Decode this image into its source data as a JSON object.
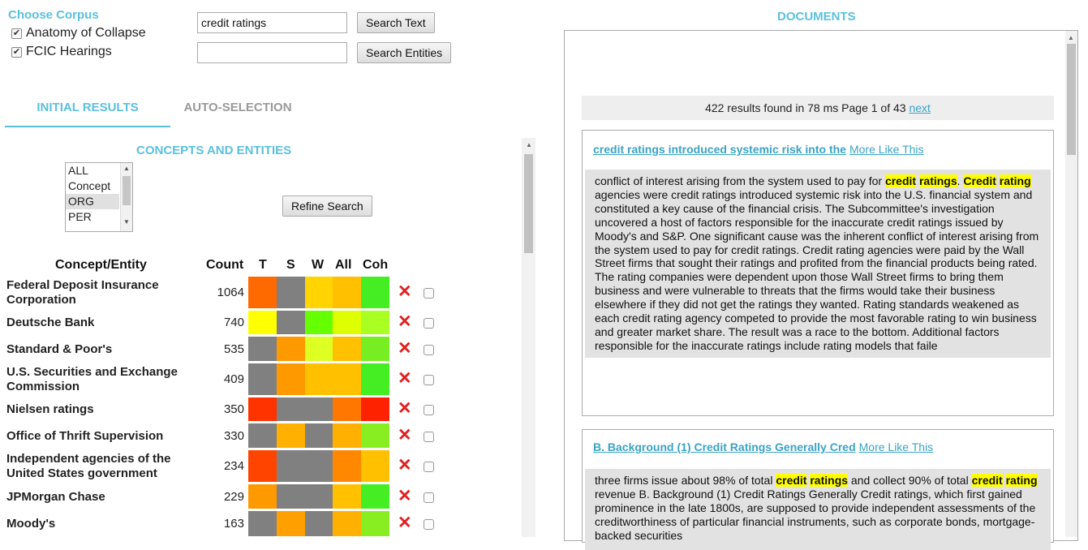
{
  "corpus": {
    "title": "Choose Corpus",
    "items": [
      {
        "label": "Anatomy of Collapse",
        "checked": true
      },
      {
        "label": "FCIC Hearings",
        "checked": true
      }
    ]
  },
  "search": {
    "text_value": "credit ratings",
    "text_button": "Search Text",
    "entities_value": "",
    "entities_button": "Search Entities"
  },
  "tabs": [
    {
      "label": "INITIAL RESULTS",
      "active": true
    },
    {
      "label": "AUTO-SELECTION",
      "active": false
    }
  ],
  "concepts": {
    "title": "CONCEPTS AND ENTITIES",
    "filter_options": [
      "ALL",
      "Concept",
      "ORG",
      "PER"
    ],
    "selected_option": "ORG",
    "refine_button": "Refine Search",
    "headers": {
      "entity": "Concept/Entity",
      "count": "Count",
      "t": "T",
      "s": "S",
      "w": "W",
      "all": "All",
      "coh": "Coh"
    },
    "rows": [
      {
        "name": "Federal Deposit Insurance Corporation",
        "count": "1064",
        "colors": [
          "#ff6a00",
          "#808080",
          "#ffd400",
          "#ffc000",
          "#44ee22"
        ]
      },
      {
        "name": "Deutsche Bank",
        "count": "740",
        "colors": [
          "#ffff00",
          "#808080",
          "#66ff00",
          "#ddff00",
          "#aaff22"
        ]
      },
      {
        "name": "Standard & Poor's",
        "count": "535",
        "colors": [
          "#808080",
          "#ff9900",
          "#ddff22",
          "#ffc000",
          "#77ee22"
        ]
      },
      {
        "name": "U.S. Securities and Exchange Commission",
        "count": "409",
        "colors": [
          "#808080",
          "#ff9900",
          "#ffc000",
          "#ffc000",
          "#44ee22"
        ]
      },
      {
        "name": "Nielsen ratings",
        "count": "350",
        "colors": [
          "#ff3300",
          "#808080",
          "#808080",
          "#ff7700",
          "#ff2200"
        ]
      },
      {
        "name": "Office of Thrift Supervision",
        "count": "330",
        "colors": [
          "#808080",
          "#ffb000",
          "#808080",
          "#ffb000",
          "#88ee22"
        ]
      },
      {
        "name": "Independent agencies of the United States government",
        "count": "234",
        "colors": [
          "#ff4400",
          "#808080",
          "#808080",
          "#ff8800",
          "#ffc000"
        ]
      },
      {
        "name": "JPMorgan Chase",
        "count": "229",
        "colors": [
          "#ff9900",
          "#808080",
          "#808080",
          "#ffc000",
          "#44ee22"
        ]
      },
      {
        "name": "Moody's",
        "count": "163",
        "colors": [
          "#808080",
          "#ffa000",
          "#808080",
          "#ffb000",
          "#88ee22"
        ]
      }
    ],
    "remove_icon": "x-icon"
  },
  "documents": {
    "title": "DOCUMENTS",
    "results_text": "422 results found in 78 ms Page 1 of 43",
    "next_label": "next",
    "more_like_this": "More Like This",
    "cards": [
      {
        "title": "credit ratings introduced systemic risk into the",
        "segments": [
          {
            "t": "conflict of interest arising from the system used to pay for ",
            "h": false
          },
          {
            "t": "credit",
            "h": true
          },
          {
            "t": " ",
            "h": false
          },
          {
            "t": "ratings",
            "h": true
          },
          {
            "t": ". ",
            "h": false
          },
          {
            "t": "Credit",
            "h": true
          },
          {
            "t": " ",
            "h": false
          },
          {
            "t": "rating",
            "h": true
          },
          {
            "t": " agencies were credit ratings introduced systemic risk into the U.S. financial system and constituted a key cause of the financial crisis. The Subcommittee's investigation uncovered a host of factors responsible for the inaccurate credit ratings issued by Moody's and S&P. One significant cause was the inherent conflict of interest arising from the system used to pay for credit ratings. Credit rating agencies were paid by the Wall Street firms that sought their ratings and profited from the financial products being rated. The rating companies were dependent upon those Wall Street firms to bring them business and were vulnerable to threats that the firms would take their business elsewhere if they did not get the ratings they wanted. Rating standards weakened as each credit rating agency competed to provide the most favorable rating to win business and greater market share. The result was a race to the bottom. Additional factors responsible for the inaccurate ratings include rating models that faile",
            "h": false
          }
        ]
      },
      {
        "title": "B. Background (1) Credit Ratings Generally Cred",
        "segments": [
          {
            "t": "three firms issue about 98% of total ",
            "h": false
          },
          {
            "t": "credit",
            "h": true
          },
          {
            "t": " ",
            "h": false
          },
          {
            "t": "ratings",
            "h": true
          },
          {
            "t": " and collect 90% of total ",
            "h": false
          },
          {
            "t": "credit",
            "h": true
          },
          {
            "t": " ",
            "h": false
          },
          {
            "t": "rating",
            "h": true
          },
          {
            "t": " revenue B. Background (1) Credit Ratings Generally Credit ratings, which first gained prominence in the late 1800s, are supposed to provide independent assessments of the creditworthiness of particular financial instruments, such as corporate bonds, mortgage-backed securities",
            "h": false
          }
        ]
      }
    ]
  },
  "colors": {
    "accent": "#5bc0de",
    "link": "#3aa3c6",
    "highlight": "#ffff00",
    "remove": "#e02020"
  }
}
